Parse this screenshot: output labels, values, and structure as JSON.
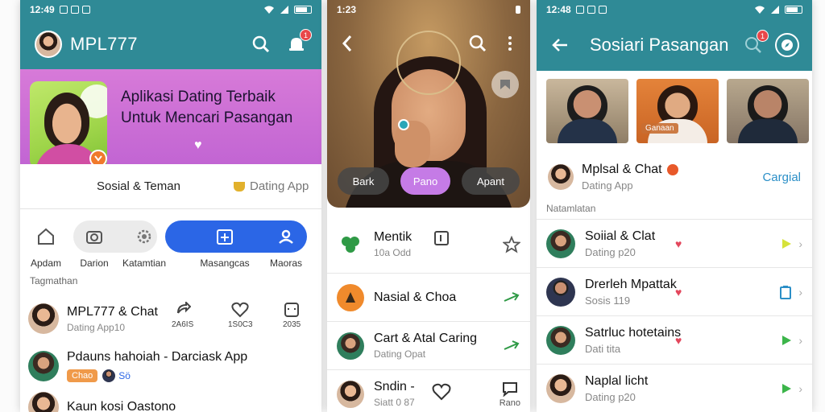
{
  "phone1": {
    "status_time": "12:49",
    "header": {
      "title": "MPL777",
      "badge": "1"
    },
    "banner": {
      "title": "Aplikasi Dating Terbaik Untuk Mencari Pasangan"
    },
    "tagline": {
      "left": "Sosial & Teman",
      "right": "Dating App"
    },
    "nav": [
      {
        "label": "Apdam",
        "icon": "home-icon"
      },
      {
        "label": "Darion",
        "icon": "camera-icon"
      },
      {
        "label": "Katamtian",
        "icon": "settings-icon"
      },
      {
        "label": "Masangcas",
        "icon": "add-card-icon"
      },
      {
        "label": "Maoras",
        "icon": "profile-icon"
      }
    ],
    "section_label": "Tagmathan",
    "list": [
      {
        "title": "MPL777 & Chat",
        "subtitle": "Dating App10",
        "stats": [
          "2A6IS",
          "1S0C3",
          "2035"
        ]
      },
      {
        "title": "Pdauns hahoiah - Darciask App",
        "chip": "Chao",
        "chip_text": "Sö"
      },
      {
        "title": "Kaun kosi Oastono"
      }
    ]
  },
  "phone2": {
    "status_time": "1:23",
    "actions": [
      "Bark",
      "Pano",
      "Apant"
    ],
    "list": [
      {
        "title": "Mentik",
        "subtitle": "10a Odd"
      },
      {
        "title": "Nasial & Choa"
      },
      {
        "title": "Cart & Atal Caring",
        "subtitle": "Dating Opat"
      },
      {
        "title": "Sndin -",
        "subtitle": "Siatt 0 87",
        "trail_label": "Rano"
      }
    ]
  },
  "phone3": {
    "status_time": "12:48",
    "header": {
      "title": "Sosiari Pasangan",
      "badge": "1"
    },
    "tile_label": "Ganaan",
    "feature": {
      "title": "Mplsal & Chat",
      "subtitle": "Dating App",
      "category": "Cargial"
    },
    "section_label": "Natamlatan",
    "list": [
      {
        "title": "Soiial & Clat",
        "subtitle": "Dating p20"
      },
      {
        "title": "Drerleh Mpattak",
        "subtitle": "Sosis 119"
      },
      {
        "title": "Satrluc hotetains",
        "subtitle": "Dati tita"
      },
      {
        "title": "Naplal licht",
        "subtitle": "Dating p20"
      }
    ]
  },
  "colors": {
    "teal": "#2f8a96",
    "blue": "#2b66e6",
    "purple": "#c57be6",
    "green": "#3cb54a"
  }
}
